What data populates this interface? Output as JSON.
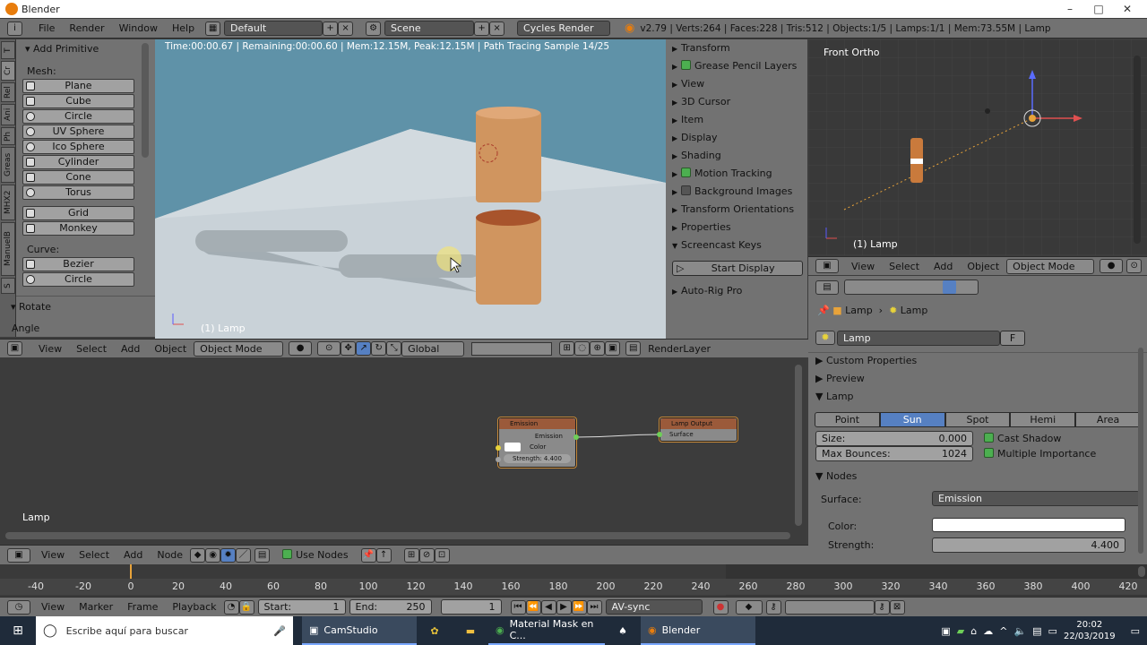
{
  "window": {
    "title": "Blender",
    "controls": [
      "–",
      "□",
      "✕"
    ]
  },
  "menu": {
    "items": [
      "File",
      "Render",
      "Window",
      "Help"
    ],
    "layout": "Default",
    "scene": "Scene",
    "engine": "Cycles Render",
    "stats": "v2.79 | Verts:264 | Faces:228 | Tris:512 | Objects:1/5 | Lamps:1/1 | Mem:73.55M | Lamp"
  },
  "shelf": {
    "tabs": [
      "T",
      "Cr",
      "Rel",
      "Ani",
      "Ph",
      "Greas",
      "MHX2",
      "ManuelB",
      "S"
    ],
    "panel_title": "Add Primitive",
    "mesh_label": "Mesh:",
    "mesh": [
      "Plane",
      "Cube",
      "Circle",
      "UV Sphere",
      "Ico Sphere",
      "Cylinder",
      "Cone",
      "Torus"
    ],
    "other": [
      "Grid",
      "Monkey"
    ],
    "curve_label": "Curve:",
    "curve": [
      "Bezier",
      "Circle"
    ],
    "rotate_title": "Rotate",
    "angle_label": "Angle"
  },
  "viewport": {
    "status": "Time:00:00.67 | Remaining:00:00.60 | Mem:12.15M, Peak:12.15M | Path Tracing Sample 14/25",
    "object_label": "(1) Lamp",
    "header": {
      "view": "View",
      "select": "Select",
      "add": "Add",
      "object": "Object",
      "mode": "Object Mode",
      "orientation": "Global",
      "render_layer": "RenderLayer"
    }
  },
  "npanel": {
    "items": [
      {
        "label": "Transform",
        "check": ""
      },
      {
        "label": "Grease Pencil Layers",
        "check": "on"
      },
      {
        "label": "View",
        "check": ""
      },
      {
        "label": "3D Cursor",
        "check": ""
      },
      {
        "label": "Item",
        "check": ""
      },
      {
        "label": "Display",
        "check": ""
      },
      {
        "label": "Shading",
        "check": ""
      },
      {
        "label": "Motion Tracking",
        "check": "on"
      },
      {
        "label": "Background Images",
        "check": "off"
      },
      {
        "label": "Transform Orientations",
        "check": ""
      },
      {
        "label": "Properties",
        "check": ""
      }
    ],
    "screencast_title": "Screencast Keys",
    "start_display": "Start Display",
    "autorig": "Auto-Rig Pro"
  },
  "ortho": {
    "label": "Front Ortho",
    "object_label": "(1) Lamp",
    "header": {
      "view": "View",
      "select": "Select",
      "add": "Add",
      "object": "Object",
      "mode": "Object Mode"
    }
  },
  "properties": {
    "breadcrumb": [
      "Lamp",
      "Lamp"
    ],
    "datablock": "Lamp",
    "fake_user": "F",
    "sections": {
      "custom": "Custom Properties",
      "preview": "Preview",
      "lamp": "Lamp",
      "nodes": "Nodes"
    },
    "lamp_types": [
      "Point",
      "Sun",
      "Spot",
      "Hemi",
      "Area"
    ],
    "active_type": "Sun",
    "size_label": "Size:",
    "size_value": "0.000",
    "bounces_label": "Max Bounces:",
    "bounces_value": "1024",
    "cast_shadow": "Cast Shadow",
    "mis": "Multiple Importance",
    "surface_label": "Surface:",
    "surface_value": "Emission",
    "color_label": "Color:",
    "strength_label": "Strength:",
    "strength_value": "4.400"
  },
  "nodes": {
    "emission": {
      "title": "Emission",
      "out": "Emission",
      "color": "Color",
      "strength": "Strength: 4.400"
    },
    "output": {
      "title": "Lamp Output",
      "surface": "Surface"
    },
    "label": "Lamp",
    "header": {
      "view": "View",
      "select": "Select",
      "add": "Add",
      "node": "Node",
      "use_nodes": "Use Nodes"
    }
  },
  "timeline": {
    "ticks": [
      "-40",
      "-20",
      "0",
      "20",
      "40",
      "60",
      "80",
      "100",
      "120",
      "140",
      "160",
      "180",
      "200",
      "220",
      "240",
      "260",
      "280",
      "300",
      "320",
      "340",
      "360",
      "380",
      "400",
      "420"
    ],
    "menu": [
      "View",
      "Marker",
      "Frame",
      "Playback"
    ],
    "start_label": "Start:",
    "start_value": "1",
    "end_label": "End:",
    "end_value": "250",
    "current": "1",
    "sync": "AV-sync"
  },
  "taskbar": {
    "search": "Escribe aquí para buscar",
    "apps": [
      "CamStudio",
      "Material Mask en C...",
      "Blender"
    ],
    "time": "20:02",
    "date": "22/03/2019"
  }
}
